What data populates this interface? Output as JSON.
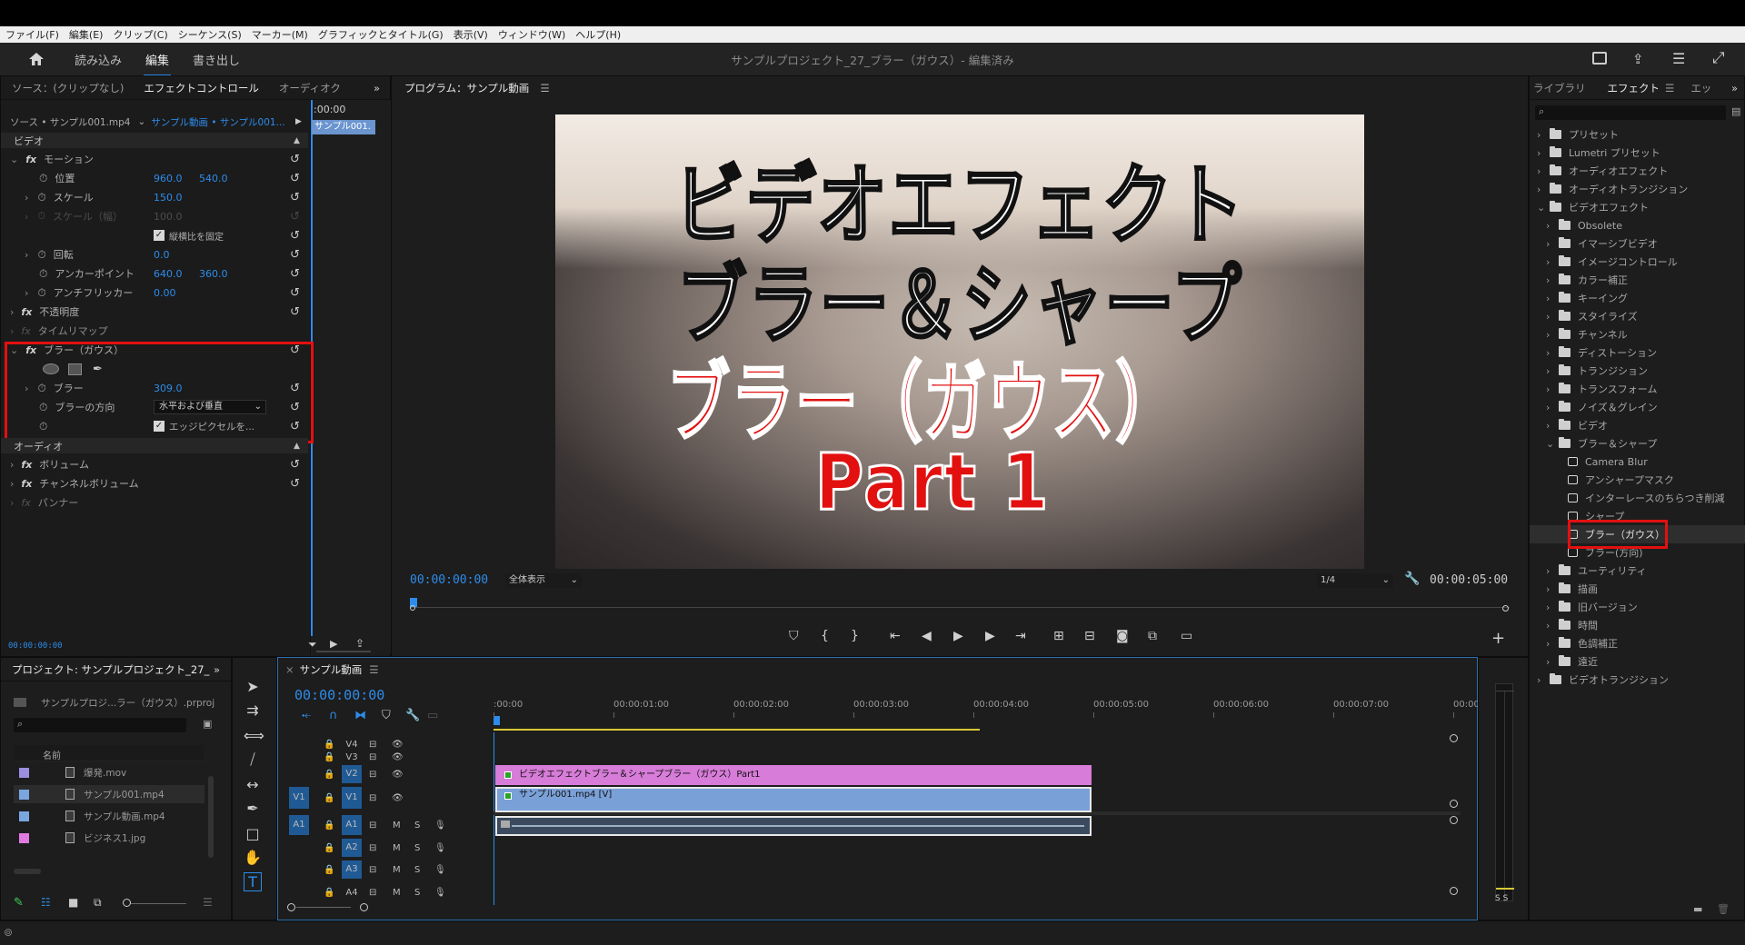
{
  "menu": [
    "ファイル(F)",
    "編集(E)",
    "クリップ(C)",
    "シーケンス(S)",
    "マーカー(M)",
    "グラフィックとタイトル(G)",
    "表示(V)",
    "ウィンドウ(W)",
    "ヘルプ(H)"
  ],
  "header": {
    "workspaces": [
      "読み込み",
      "編集",
      "書き出し"
    ],
    "project_title": "サンプルプロジェクト_27_ブラー（ガウス）- 編集済み"
  },
  "effect_controls": {
    "tabs": [
      "ソース：(クリップなし)",
      "エフェクトコントロール",
      "オーディオク"
    ],
    "source_label": "ソース • サンプル001.mp4",
    "seq_label": "サンプル動画 • サンプル001...",
    "time_head": ":00:00",
    "clip_label": "サンプル001.",
    "video_section": "ビデオ",
    "motion": "モーション",
    "position_label": "位置",
    "position_x": "960.0",
    "position_y": "540.0",
    "scale_label": "スケール",
    "scale_val": "150.0",
    "scale_w_label": "スケール（幅）",
    "scale_w_val": "100.0",
    "uniform_label": "縦横比を固定",
    "rotation_label": "回転",
    "rotation_val": "0.0",
    "anchor_label": "アンカーポイント",
    "anchor_x": "640.0",
    "anchor_y": "360.0",
    "flicker_label": "アンチフリッカー",
    "flicker_val": "0.00",
    "opacity": "不透明度",
    "timeremap": "タイムリマップ",
    "blur_effect": "ブラー（ガウス）",
    "blurriness_label": "ブラー",
    "blurriness_val": "309.0",
    "blur_dim_label": "ブラーの方向",
    "blur_dim_val": "水平および垂直",
    "repeat_edge_label": "エッジピクセルを...",
    "audio_section": "オーディオ",
    "volume": "ボリューム",
    "channel_volume": "チャンネルボリューム",
    "panner": "パンナー",
    "timecode": "00:00:00:00"
  },
  "program": {
    "title": "プログラム：サンプル動画",
    "overlay_lines": [
      "ビデオエフェクト",
      "ブラー＆シャープ",
      "ブラー（ガウス）",
      "Part 1"
    ],
    "timecode": "00:00:00:00",
    "fit": "全体表示",
    "resolution": "1/4",
    "duration": "00:00:05:00"
  },
  "effects_panel": {
    "tabs": [
      "ライブラリ",
      "エフェクト",
      "エッ"
    ],
    "items": [
      {
        "label": "プリセット",
        "level": 0,
        "kind": "folder"
      },
      {
        "label": "Lumetri プリセット",
        "level": 0,
        "kind": "folder"
      },
      {
        "label": "オーディオエフェクト",
        "level": 0,
        "kind": "folder"
      },
      {
        "label": "オーディオトランジション",
        "level": 0,
        "kind": "folder"
      },
      {
        "label": "ビデオエフェクト",
        "level": 0,
        "kind": "folder",
        "open": true
      },
      {
        "label": "Obsolete",
        "level": 1,
        "kind": "folder"
      },
      {
        "label": "イマーシブビデオ",
        "level": 1,
        "kind": "folder"
      },
      {
        "label": "イメージコントロール",
        "level": 1,
        "kind": "folder"
      },
      {
        "label": "カラー補正",
        "level": 1,
        "kind": "folder"
      },
      {
        "label": "キーイング",
        "level": 1,
        "kind": "folder"
      },
      {
        "label": "スタイライズ",
        "level": 1,
        "kind": "folder"
      },
      {
        "label": "チャンネル",
        "level": 1,
        "kind": "folder"
      },
      {
        "label": "ディストーション",
        "level": 1,
        "kind": "folder"
      },
      {
        "label": "トランジション",
        "level": 1,
        "kind": "folder"
      },
      {
        "label": "トランスフォーム",
        "level": 1,
        "kind": "folder"
      },
      {
        "label": "ノイズ＆グレイン",
        "level": 1,
        "kind": "folder"
      },
      {
        "label": "ビデオ",
        "level": 1,
        "kind": "folder"
      },
      {
        "label": "ブラー＆シャープ",
        "level": 1,
        "kind": "folder",
        "open": true
      },
      {
        "label": "Camera Blur",
        "level": 2,
        "kind": "fx"
      },
      {
        "label": "アンシャープマスク",
        "level": 2,
        "kind": "fx"
      },
      {
        "label": "インターレースのちらつき削減",
        "level": 2,
        "kind": "fx"
      },
      {
        "label": "シャープ",
        "level": 2,
        "kind": "fx"
      },
      {
        "label": "ブラー（ガウス）",
        "level": 2,
        "kind": "fx",
        "selected": true
      },
      {
        "label": "ブラー(方向)",
        "level": 2,
        "kind": "fx"
      },
      {
        "label": "ユーティリティ",
        "level": 1,
        "kind": "folder"
      },
      {
        "label": "描画",
        "level": 1,
        "kind": "folder"
      },
      {
        "label": "旧バージョン",
        "level": 1,
        "kind": "folder"
      },
      {
        "label": "時間",
        "level": 1,
        "kind": "folder"
      },
      {
        "label": "色調補正",
        "level": 1,
        "kind": "folder"
      },
      {
        "label": "遠近",
        "level": 1,
        "kind": "folder"
      },
      {
        "label": "ビデオトランジション",
        "level": 0,
        "kind": "folder"
      }
    ]
  },
  "project": {
    "tab": "プロジェクト: サンプルプロジェクト_27_",
    "file": "サンプルプロジ...ラー（ガウス）.prproj",
    "col_name": "名前",
    "items": [
      {
        "name": "爆発.mov",
        "color": "#9b8ee0"
      },
      {
        "name": "サンプル001.mp4",
        "color": "#7aa6e0"
      },
      {
        "name": "サンプル動画.mp4",
        "color": "#7aa6e0"
      },
      {
        "name": "ビジネス1.jpg",
        "color": "#e07ae0"
      }
    ]
  },
  "timeline": {
    "tab": "サンプル動画",
    "timecode": "00:00:00:00",
    "ruler": [
      ":00:00",
      "00:00:01:00",
      "00:00:02:00",
      "00:00:03:00",
      "00:00:04:00",
      "00:00:05:00",
      "00:00:06:00",
      "00:00:07:00",
      "00:00:"
    ],
    "tracks_video": [
      "V4",
      "V3",
      "V2",
      "V1"
    ],
    "tracks_audio": [
      "A1",
      "A2",
      "A3",
      "A4"
    ],
    "clip_title": "ビデオエフェクトブラー＆シャープブラー（ガウス）Part1",
    "clip_video": "サンプル001.mp4 [V]",
    "meter_label": "S S"
  }
}
